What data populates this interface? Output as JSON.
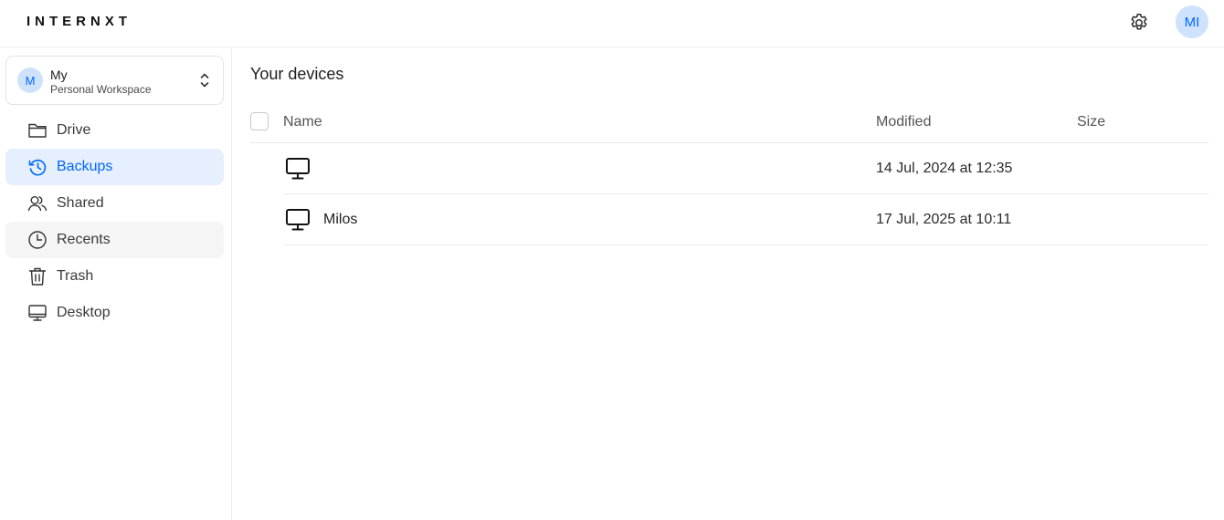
{
  "header": {
    "logo": "INTERNXT",
    "settings_icon": "gear-icon",
    "user_initials": "MI",
    "accent_color": "#0066ff"
  },
  "sidebar": {
    "workspace": {
      "initial": "M",
      "name": "My",
      "subtitle": "Personal Workspace"
    },
    "items": [
      {
        "label": "Drive",
        "icon": "folder-icon",
        "active": false
      },
      {
        "label": "Backups",
        "icon": "history-icon",
        "active": true
      },
      {
        "label": "Shared",
        "icon": "users-icon",
        "active": false
      },
      {
        "label": "Recents",
        "icon": "clock-icon",
        "active": false
      },
      {
        "label": "Trash",
        "icon": "trash-icon",
        "active": false
      },
      {
        "label": "Desktop",
        "icon": "desktop-icon",
        "active": false
      }
    ]
  },
  "main": {
    "title": "Your devices",
    "columns": {
      "name": "Name",
      "modified": "Modified",
      "size": "Size"
    },
    "rows": [
      {
        "name": "",
        "modified": "14 Jul, 2024 at 12:35",
        "size": "",
        "icon": "monitor-icon"
      },
      {
        "name": "Milos",
        "modified": "17 Jul, 2025 at 10:11",
        "size": "",
        "icon": "monitor-icon"
      }
    ]
  }
}
